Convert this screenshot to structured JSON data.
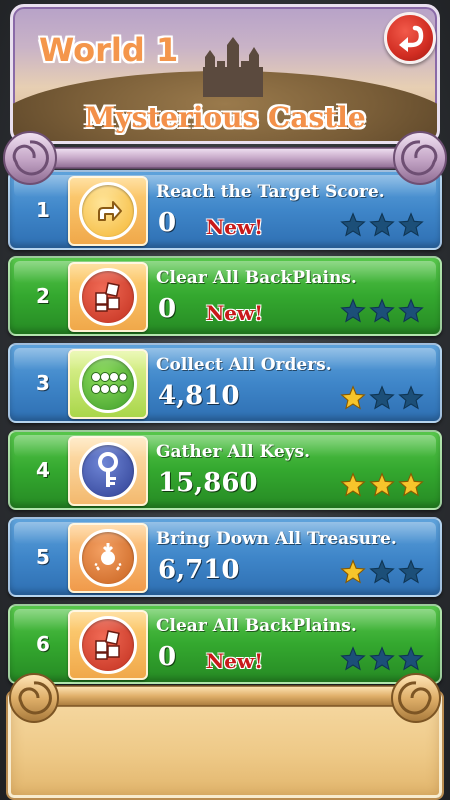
{
  "header": {
    "world_title": "World 1",
    "level_set_name": "Mysterious Castle",
    "back_button_icon": "back-arrow-icon"
  },
  "colors": {
    "blue_row": "#3f86c9",
    "green_row": "#34a82f",
    "star_earned": "#f7c52b",
    "star_empty": "#1c4f78",
    "new_tag": "#c81a1a",
    "title_orange": "#f4964b"
  },
  "levels": [
    {
      "number": "1",
      "goal": "Reach the Target Score.",
      "score": "0",
      "new_label": "New!",
      "stars_earned": 0,
      "icon": "arrow-up-right-icon",
      "row_color": "blue"
    },
    {
      "number": "2",
      "goal": "Clear All BackPlains.",
      "score": "0",
      "new_label": "New!",
      "stars_earned": 0,
      "icon": "tiles-icon",
      "row_color": "green"
    },
    {
      "number": "3",
      "goal": "Collect All Orders.",
      "score": "4,810",
      "new_label": "",
      "stars_earned": 1,
      "icon": "orders-dots-icon",
      "row_color": "blue"
    },
    {
      "number": "4",
      "goal": "Gather All Keys.",
      "score": "15,860",
      "new_label": "",
      "stars_earned": 3,
      "icon": "key-icon",
      "row_color": "green"
    },
    {
      "number": "5",
      "goal": "Bring Down All Treasure.",
      "score": "6,710",
      "new_label": "",
      "stars_earned": 1,
      "icon": "treasure-icon",
      "row_color": "blue"
    },
    {
      "number": "6",
      "goal": "Clear All BackPlains.",
      "score": "0",
      "new_label": "New!",
      "stars_earned": 0,
      "icon": "tiles-icon",
      "row_color": "green"
    }
  ]
}
